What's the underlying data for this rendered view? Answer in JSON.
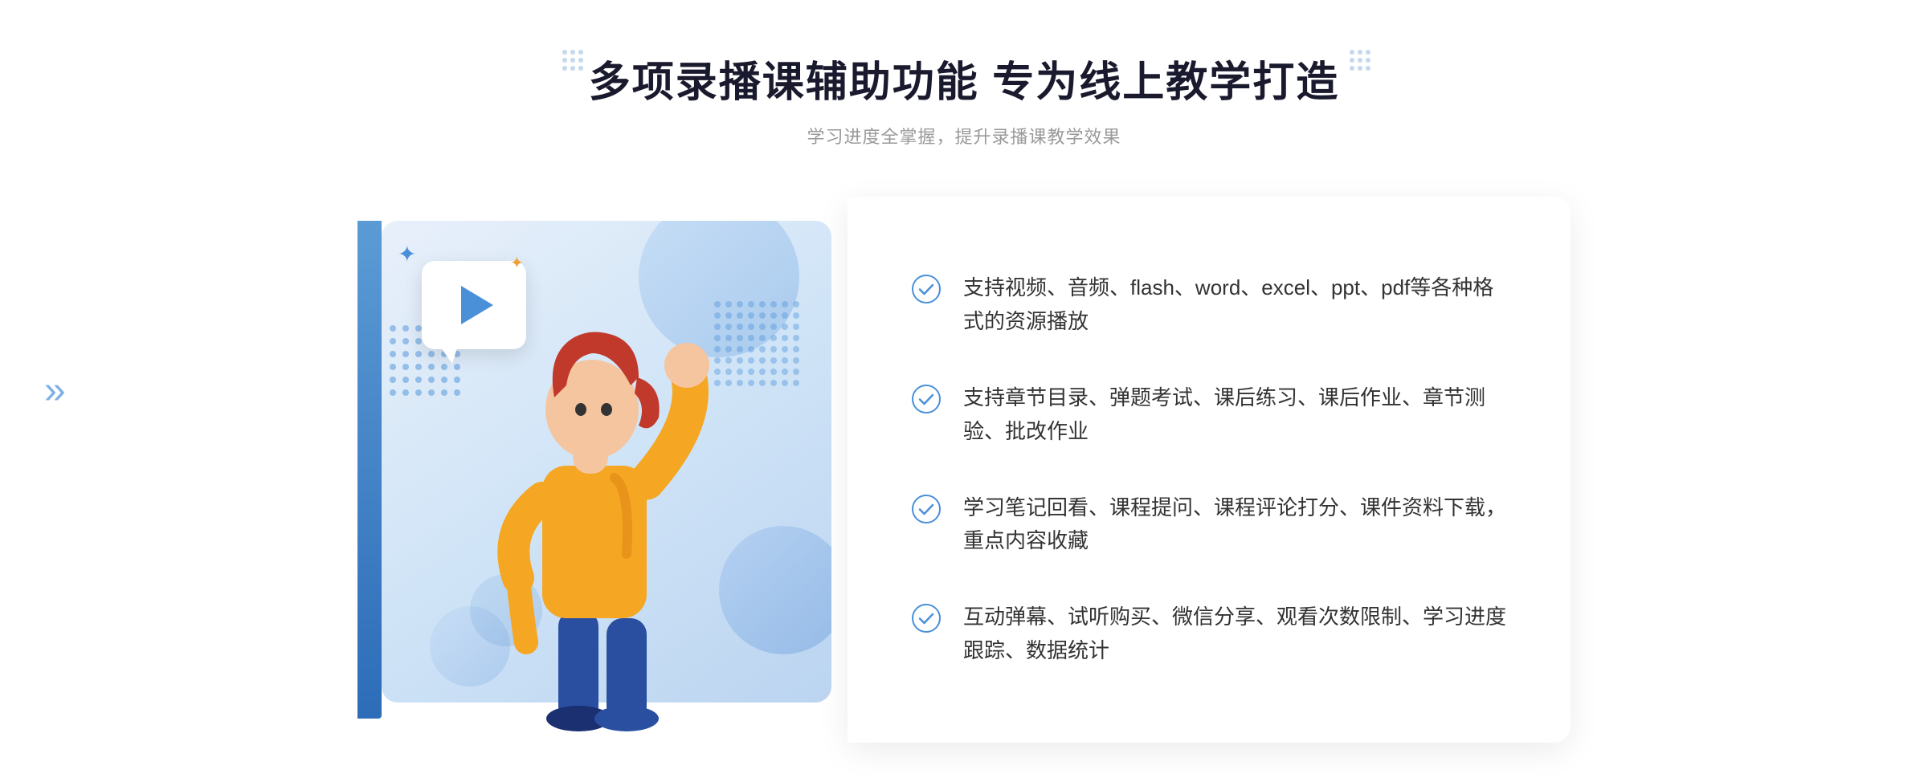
{
  "page": {
    "background": "#ffffff"
  },
  "header": {
    "main_title": "多项录播课辅助功能 专为线上教学打造",
    "sub_title": "学习进度全掌握，提升录播课教学效果"
  },
  "features": [
    {
      "id": 1,
      "text": "支持视频、音频、flash、word、excel、ppt、pdf等各种格式的资源播放"
    },
    {
      "id": 2,
      "text": "支持章节目录、弹题考试、课后练习、课后作业、章节测验、批改作业"
    },
    {
      "id": 3,
      "text": "学习笔记回看、课程提问、课程评论打分、课件资料下载，重点内容收藏"
    },
    {
      "id": 4,
      "text": "互动弹幕、试听购买、微信分享、观看次数限制、学习进度跟踪、数据统计"
    }
  ],
  "icons": {
    "check": "check-circle-icon",
    "play": "play-icon",
    "double_chevron": "»"
  },
  "colors": {
    "primary_blue": "#4a90d9",
    "dark_blue": "#2d6cb8",
    "text_dark": "#1a1a2e",
    "text_light": "#999999",
    "text_body": "#333333"
  }
}
